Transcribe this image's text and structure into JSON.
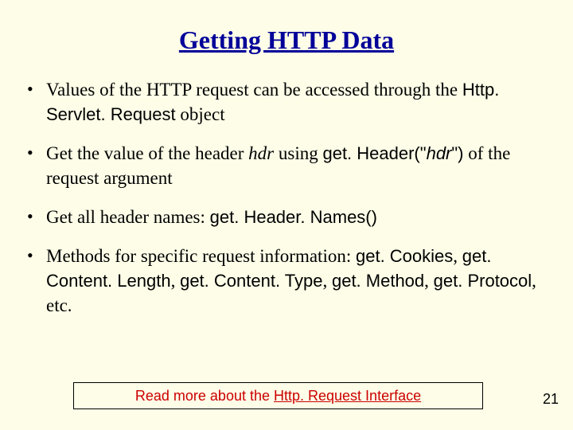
{
  "title": "Getting HTTP Data",
  "bullets": {
    "b1": {
      "t1": "Values of the HTTP request can be accessed through the ",
      "t2": "Http. Servlet. Request",
      "t3": " object"
    },
    "b2": {
      "t1": "Get the value of the header ",
      "t2": "hdr",
      "t3": "  using ",
      "t4": "get. Header(\"",
      "t5": "hdr",
      "t6": "\")",
      "t7": " of the request argument"
    },
    "b3": {
      "t1": "Get all header names: ",
      "t2": "get. Header. Names()"
    },
    "b4": {
      "t1": "Methods for specific request information: ",
      "t2": "get. Cookies",
      "t3": ", ",
      "t4": "get. Content. Length",
      "t5": ", ",
      "t6": "get. Content. Type",
      "t7": ", ",
      "t8": "get. Method",
      "t9": ", ",
      "t10": "get. Protocol",
      "t11": ", etc."
    }
  },
  "footer": {
    "prefix": "Read more about the ",
    "link": "Http. Request Interface"
  },
  "page_number": "21"
}
